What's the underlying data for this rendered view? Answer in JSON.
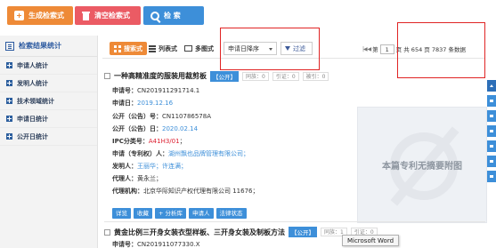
{
  "toolbar": {
    "generate_label": "生成检索式",
    "clear_label": "清空检索式",
    "search_label": "检 索"
  },
  "left_panel": {
    "title": "检索结果统计",
    "items": [
      {
        "label": "申请人统计"
      },
      {
        "label": "发明人统计"
      },
      {
        "label": "技术领域统计"
      },
      {
        "label": "申请日统计"
      },
      {
        "label": "公开日统计"
      }
    ]
  },
  "view_bar": {
    "tabs": [
      "搜索式",
      "列表式",
      "多图式"
    ],
    "sort_label": "申请日降序",
    "filter_label": "过滤",
    "pager": {
      "nav_prev": "|◀ ◀",
      "page_prefix": "第",
      "page_value": "1",
      "page_suffix": "页 共 654 页 7837 条数据"
    }
  },
  "record1": {
    "title": "一种高精准度的服装用裁剪板",
    "badge": "【公开】",
    "pills": [
      "同族：0",
      "引证：0",
      "被引：0"
    ],
    "fields": {
      "app_no_label": "申请号：",
      "app_no": "CN201911291714.1",
      "app_date_label": "申请日：",
      "app_date": "2019.12.16",
      "pub_no_label": "公开（公告）号：",
      "pub_no": "CN110786578A",
      "pub_date_label": "公开（公告）日：",
      "pub_date": "2020.02.14",
      "ipc_label": "IPC分类号：",
      "ipc": "A41H3/01",
      "ipc_tail": "；",
      "applicant_label": "申请（专利权）人：",
      "applicant": "湖州飘也品牌管理有限公司；",
      "inventor_label": "发明人：",
      "inventor": "王丽华；许连满；",
      "agent_label": "代理人：",
      "agent": "黄永兰；",
      "agency_label": "代理机构：",
      "agency": "北京华际知识产权代理有限公司 11676；"
    },
    "image_placeholder": "本篇专利无摘要附图",
    "actions": [
      "详览",
      "收藏",
      "+ 分析库",
      "申请人",
      "法律状态"
    ]
  },
  "record2": {
    "title": "黄金比例三开身女装衣型样板、三开身女装及制板方法",
    "badge": "【公开】",
    "pills": [
      "同族：1",
      "引证：0"
    ],
    "app_no_label": "申请号：",
    "app_no": "CN201911077330.X"
  },
  "tooltip": {
    "text": "Microsoft Word"
  },
  "colors": {
    "accent_orange": "#ee8a37",
    "accent_red": "#eb5b64",
    "accent_blue": "#3d8fd9",
    "highlight_red": "#e02424"
  }
}
